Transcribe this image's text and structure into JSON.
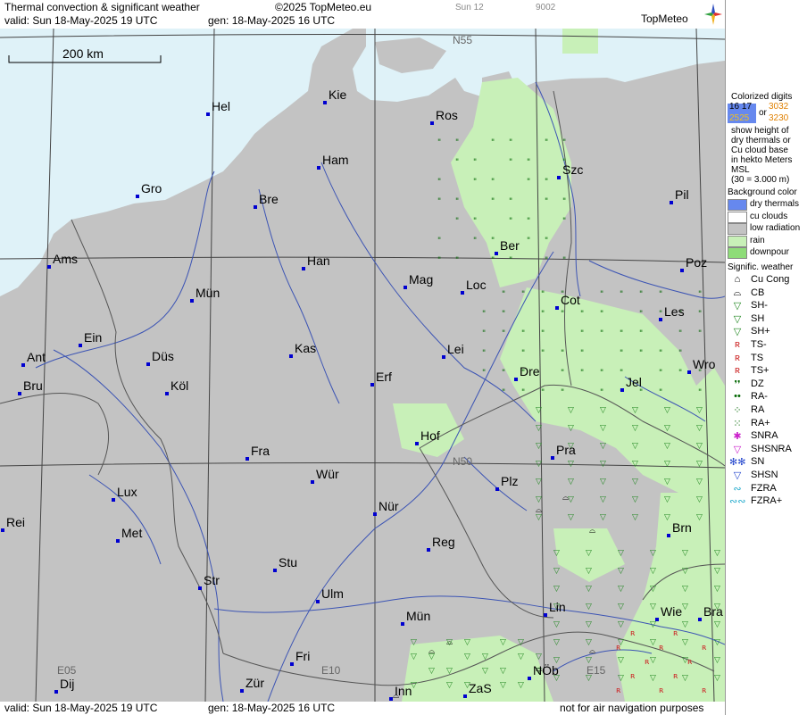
{
  "header": {
    "title": "Thermal convection & significant weather",
    "copyright": "©2025 TopMeteo.eu",
    "day_code": "Sun 12",
    "code": "9002",
    "valid": "valid:  Sun  18-May-2025  19 UTC",
    "gen": "gen: 18-May-2025 16 UTC",
    "logo": "TopMeteo"
  },
  "footer": {
    "valid": "valid:  Sun  18-May-2025  19 UTC",
    "gen": "gen: 18-May-2025 16 UTC",
    "note": "not for air navigation purposes"
  },
  "map": {
    "scale_label": "200 km",
    "grid_labels": {
      "n55": "N55",
      "n50": "N50",
      "e05": "E05",
      "e10": "E10",
      "e15": "E15"
    },
    "colors": {
      "sea": "#dff2f8",
      "land": "#c3c3c3",
      "rain": "#c8f0b8",
      "grid": "#444444",
      "river": "#3c54b4",
      "border": "#555555",
      "city": "#0000d0"
    },
    "cities": [
      {
        "name": "Hel"
      },
      {
        "name": "Kie"
      },
      {
        "name": "Ros"
      },
      {
        "name": "Ham"
      },
      {
        "name": "Gro"
      },
      {
        "name": "Bre"
      },
      {
        "name": "Szc"
      },
      {
        "name": "Pil"
      },
      {
        "name": "Ber"
      },
      {
        "name": "Ams"
      },
      {
        "name": "Han"
      },
      {
        "name": "Poz"
      },
      {
        "name": "Mag"
      },
      {
        "name": "Loc"
      },
      {
        "name": "Mün"
      },
      {
        "name": "Cot"
      },
      {
        "name": "Les"
      },
      {
        "name": "Ein"
      },
      {
        "name": "Kas"
      },
      {
        "name": "Lei"
      },
      {
        "name": "Ant"
      },
      {
        "name": "Düs"
      },
      {
        "name": "Wro"
      },
      {
        "name": "Dre"
      },
      {
        "name": "Erf"
      },
      {
        "name": "Köl"
      },
      {
        "name": "Jel"
      },
      {
        "name": "Bru"
      },
      {
        "name": "Hof"
      },
      {
        "name": "Fra"
      },
      {
        "name": "Pra"
      },
      {
        "name": "Wür"
      },
      {
        "name": "Plz"
      },
      {
        "name": "Lux"
      },
      {
        "name": "Nür"
      },
      {
        "name": "Rei"
      },
      {
        "name": "Met"
      },
      {
        "name": "Brn"
      },
      {
        "name": "Reg"
      },
      {
        "name": "Stu"
      },
      {
        "name": "Str"
      },
      {
        "name": "Ulm"
      },
      {
        "name": "Lin"
      },
      {
        "name": "Wie"
      },
      {
        "name": "Bra"
      },
      {
        "name": "Mün"
      },
      {
        "name": "Fri"
      },
      {
        "name": "NÖb"
      },
      {
        "name": "Dij"
      },
      {
        "name": "Zür"
      },
      {
        "name": "Inn"
      },
      {
        "name": "ZaS"
      }
    ]
  },
  "legend": {
    "digits_title": "Colorized digits",
    "digits_sample_a": "16  17",
    "digits_sample_b": "2525",
    "digits_or": "or",
    "digits_sample_c": "3032",
    "digits_sample_d": "3230",
    "digits_desc": [
      "show height of",
      "dry thermals or",
      "Cu cloud base",
      "in hekto Meters",
      "MSL",
      "(30 = 3.000 m)"
    ],
    "bg_title": "Background color",
    "bg_items": [
      {
        "label": "dry thermals",
        "color": "#6688ee"
      },
      {
        "label": "cu clouds",
        "color": "#ffffff"
      },
      {
        "label": "low radiation",
        "color": "#c3c3c3"
      },
      {
        "label": "rain",
        "color": "#c8f0b8"
      },
      {
        "label": "downpour",
        "color": "#8edc78"
      }
    ],
    "sig_title": "Signific. weather",
    "sig_items": [
      {
        "label": "Cu Cong",
        "icon": "cu-cong-icon",
        "symbol": "⌂",
        "color": "#000000"
      },
      {
        "label": "CB",
        "icon": "cb-icon",
        "symbol": "⌓",
        "color": "#000000"
      },
      {
        "label": "SH-",
        "icon": "shower-light-icon",
        "symbol": "▽",
        "color": "#228822"
      },
      {
        "label": "SH",
        "icon": "shower-icon",
        "symbol": "▽",
        "color": "#228822"
      },
      {
        "label": "SH+",
        "icon": "shower-heavy-icon",
        "symbol": "▽",
        "color": "#228822"
      },
      {
        "label": "TS-",
        "icon": "thunderstorm-light-icon",
        "symbol": "ʀ",
        "color": "#cc2222"
      },
      {
        "label": "TS",
        "icon": "thunderstorm-icon",
        "symbol": "ʀ",
        "color": "#cc2222"
      },
      {
        "label": "TS+",
        "icon": "thunderstorm-heavy-icon",
        "symbol": "ʀ",
        "color": "#cc2222"
      },
      {
        "label": "DZ",
        "icon": "drizzle-icon",
        "symbol": "❜❜",
        "color": "#006600"
      },
      {
        "label": "RA-",
        "icon": "rain-light-icon",
        "symbol": "••",
        "color": "#006600"
      },
      {
        "label": "RA",
        "icon": "rain-icon",
        "symbol": "⁘",
        "color": "#006600"
      },
      {
        "label": "RA+",
        "icon": "rain-heavy-icon",
        "symbol": "⁙",
        "color": "#006600"
      },
      {
        "label": "SNRA",
        "icon": "snow-rain-icon",
        "symbol": "✱",
        "color": "#cc22cc"
      },
      {
        "label": "SHSNRA",
        "icon": "snow-rain-shower-icon",
        "symbol": "▽",
        "color": "#cc22cc"
      },
      {
        "label": "SN",
        "icon": "snow-icon",
        "symbol": "✻✻",
        "color": "#2244cc"
      },
      {
        "label": "SHSN",
        "icon": "snow-shower-icon",
        "symbol": "▽",
        "color": "#2244cc"
      },
      {
        "label": "FZRA",
        "icon": "freezing-rain-icon",
        "symbol": "∾",
        "color": "#22aacc"
      },
      {
        "label": "FZRA+",
        "icon": "freezing-rain-heavy-icon",
        "symbol": "∾∾",
        "color": "#22aacc"
      }
    ]
  }
}
